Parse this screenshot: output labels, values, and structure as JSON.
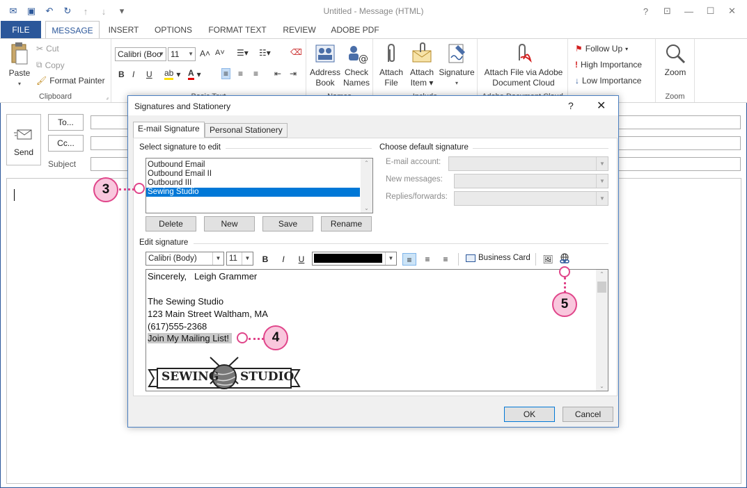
{
  "window": {
    "title": "Untitled - Message (HTML)"
  },
  "tabs": [
    "FILE",
    "MESSAGE",
    "INSERT",
    "OPTIONS",
    "FORMAT TEXT",
    "REVIEW",
    "ADOBE PDF"
  ],
  "ribbon": {
    "clipboard": {
      "paste": "Paste",
      "cut": "Cut",
      "copy": "Copy",
      "format_painter": "Format Painter",
      "label": "Clipboard"
    },
    "basic_text": {
      "font": "Calibri (Boo",
      "size": "11",
      "label": "Basic Text"
    },
    "names": {
      "address_book_l1": "Address",
      "address_book_l2": "Book",
      "check_names_l1": "Check",
      "check_names_l2": "Names",
      "label": "Names"
    },
    "include": {
      "attach_file_l1": "Attach",
      "attach_file_l2": "File",
      "attach_item_l1": "Attach",
      "attach_item_l2": "Item",
      "signature": "Signature",
      "label": "Include"
    },
    "adobe": {
      "line1": "Attach File via Adobe",
      "line2": "Document Cloud",
      "label": "Adobe Document Cloud"
    },
    "tags": {
      "follow_up": "Follow Up",
      "high": "High Importance",
      "low": "Low Importance"
    },
    "zoom": {
      "button": "Zoom",
      "label": "Zoom"
    }
  },
  "header": {
    "send": "Send",
    "to": "To...",
    "cc": "Cc...",
    "subject": "Subject"
  },
  "dialog": {
    "title": "Signatures and Stationery",
    "help": "?",
    "close": "✕",
    "tab_email": "E-mail Signature",
    "tab_stationery": "Personal Stationery",
    "select_label": "Select signature to edit",
    "signatures": [
      "Outbound Email",
      "Outbound Email II",
      "Outbound III",
      "Sewing Studio"
    ],
    "selected_index": 3,
    "btn_delete": "Delete",
    "btn_new": "New",
    "btn_save": "Save",
    "btn_rename": "Rename",
    "default_label": "Choose default signature",
    "email_account": "E-mail account:",
    "new_messages": "New messages:",
    "replies": "Replies/forwards:",
    "edit_label": "Edit signature",
    "font": "Calibri (Body)",
    "size": "11",
    "business_card": "Business Card",
    "editor_lines": [
      "Sincerely,   Leigh Grammer",
      "",
      "The Sewing Studio",
      "123 Main Street Waltham, MA",
      "(617)555-2368",
      "Join My Mailing List!"
    ],
    "logo_left": "SEWING",
    "logo_right": "STUDIO",
    "ok": "OK",
    "cancel": "Cancel"
  },
  "callouts": {
    "c3": "3",
    "c4": "4",
    "c5": "5"
  },
  "colors": {
    "accent": "#2b579a",
    "callout": "#e0458a",
    "selection": "#0078d7"
  }
}
